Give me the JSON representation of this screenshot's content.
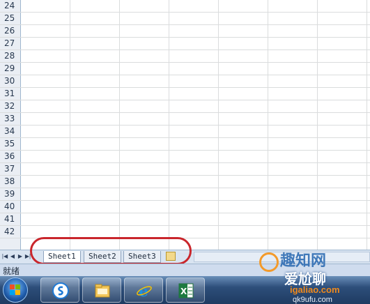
{
  "rows": [
    "24",
    "25",
    "26",
    "27",
    "28",
    "29",
    "30",
    "31",
    "32",
    "33",
    "34",
    "35",
    "36",
    "37",
    "38",
    "39",
    "40",
    "41",
    "42"
  ],
  "sheet_tabs": [
    "Sheet1",
    "Sheet2",
    "Sheet3"
  ],
  "status": "就绪",
  "taskbar": {
    "apps": [
      "sogou-browser",
      "file-explorer",
      "internet-explorer",
      "excel"
    ]
  },
  "watermark": {
    "line1": "趣知网",
    "line2": "爱尬聊",
    "line3": "igaliao.com",
    "line4": "qk9ufu.com"
  },
  "colors": {
    "highlight": "#c9262c",
    "tab_bar": "#d9e4f1",
    "taskbar": "#2d4e7a"
  }
}
